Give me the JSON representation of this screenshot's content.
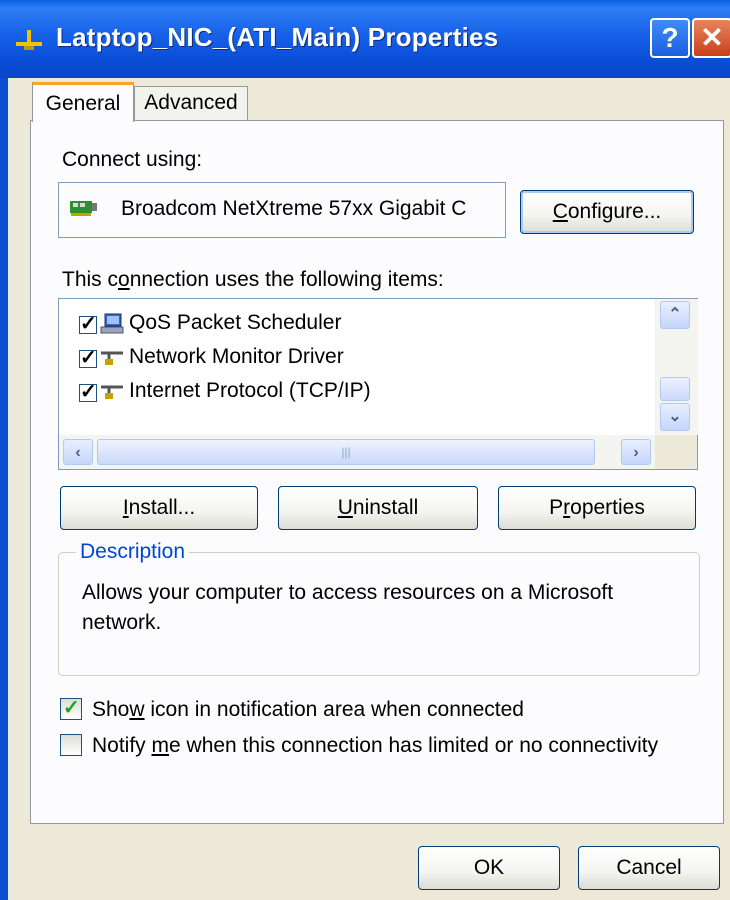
{
  "window": {
    "title": "Latptop_NIC_(ATI_Main) Properties",
    "help_button": "?",
    "close_button": "✕"
  },
  "tabs": [
    {
      "label": "General",
      "selected": true
    },
    {
      "label": "Advanced",
      "selected": false
    }
  ],
  "connect_using": {
    "label": "Connect using:",
    "adapter": "Broadcom NetXtreme 57xx Gigabit C",
    "configure": {
      "pre": "",
      "accel": "C",
      "post": "onfigure..."
    }
  },
  "items": {
    "label": {
      "pre": "This c",
      "accel": "o",
      "post": "nnection uses the following items:"
    },
    "list": [
      {
        "label": "QoS Packet Scheduler",
        "checked": true,
        "icon": "scheduler-icon"
      },
      {
        "label": "Network Monitor Driver",
        "checked": true,
        "icon": "protocol-icon"
      },
      {
        "label": "Internet Protocol (TCP/IP)",
        "checked": true,
        "icon": "protocol-icon"
      }
    ]
  },
  "buttons": {
    "install": {
      "pre": "",
      "accel": "I",
      "post": "nstall..."
    },
    "uninstall": {
      "pre": "",
      "accel": "U",
      "post": "ninstall"
    },
    "properties": {
      "pre": "P",
      "accel": "r",
      "post": "operties"
    }
  },
  "description": {
    "legend": "Description",
    "text": "Allows your computer to access resources on a Microsoft network."
  },
  "options": {
    "show_icon": {
      "pre": "Sho",
      "accel": "w",
      "post": " icon in notification area when connected",
      "checked": true
    },
    "notify": {
      "pre": "Notify ",
      "accel": "m",
      "post": "e when this connection has limited or no connectivity",
      "checked": false
    }
  },
  "footer": {
    "ok": "OK",
    "cancel": "Cancel"
  },
  "colors": {
    "title_bar": "#0b4fd8",
    "accent_tab": "#f5a623",
    "legend": "#0046d5"
  }
}
